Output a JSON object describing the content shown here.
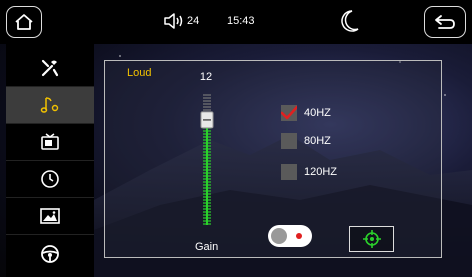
{
  "status_bar": {
    "volume": "24",
    "time": "15:43"
  },
  "sidebar": {
    "items": [
      {
        "icon": "tools-icon",
        "active": false
      },
      {
        "icon": "music-note-settings-icon",
        "active": true
      },
      {
        "icon": "tv-icon",
        "active": false
      },
      {
        "icon": "clock-icon",
        "active": false
      },
      {
        "icon": "image-icon",
        "active": false
      },
      {
        "icon": "steering-wheel-icon",
        "active": false
      }
    ]
  },
  "panel": {
    "loud_label": "Loud",
    "gain_value": "12",
    "gain_label": "Gain",
    "gain_level_fraction": 0.13,
    "frequencies": [
      {
        "label": "40HZ",
        "checked": true
      },
      {
        "label": "80HZ",
        "checked": false
      },
      {
        "label": "120HZ",
        "checked": false
      }
    ],
    "toggle_on": false
  },
  "colors": {
    "accent_yellow": "#f2c200",
    "slider_green": "#2bd12b",
    "check_red": "#e02020"
  }
}
